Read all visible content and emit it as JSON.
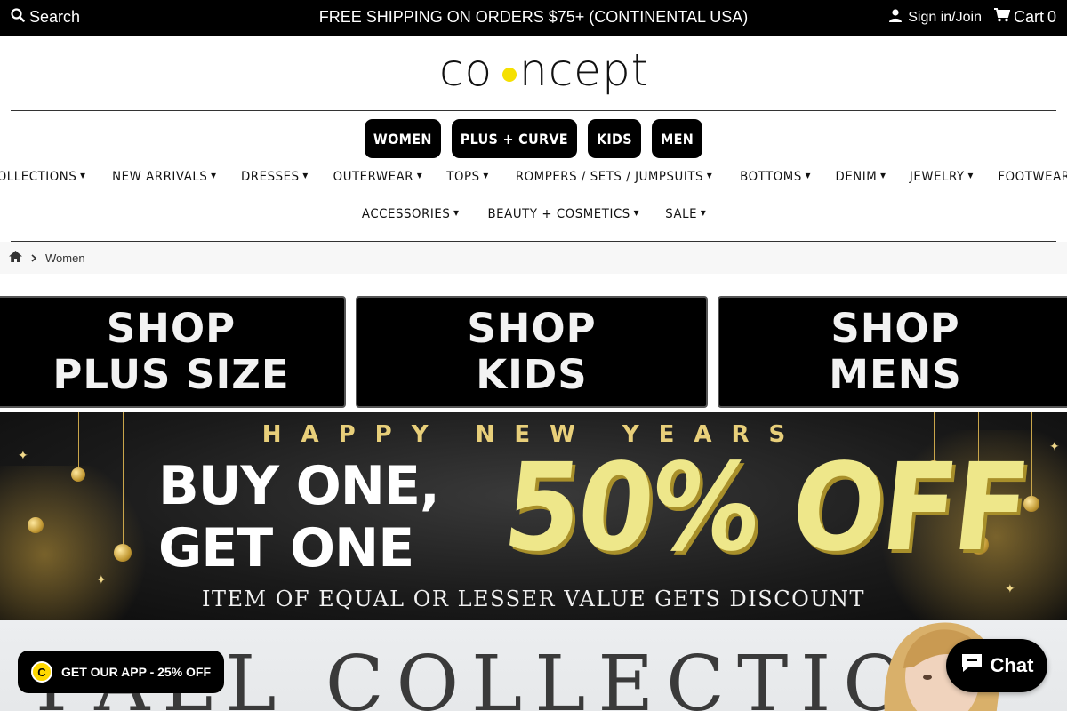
{
  "topbar": {
    "search_label": "Search",
    "promo": "FREE SHIPPING ON ORDERS $75+ (CONTINENTAL USA)",
    "signin_label": "Sign in/Join",
    "cart_label": "Cart",
    "cart_count": "0"
  },
  "logo": {
    "text": "co ncept",
    "accent_color": "#f5e000"
  },
  "pills": [
    "WOMEN",
    "PLUS + CURVE",
    "KIDS",
    "MEN"
  ],
  "nav": {
    "row1": [
      "COLLECTIONS",
      "NEW ARRIVALS",
      "DRESSES",
      "OUTERWEAR",
      "TOPS",
      "ROMPERS / SETS / JUMPSUITS",
      "BOTTOMS",
      "DENIM",
      "JEWELRY",
      "FOOTWEAR"
    ],
    "row2": [
      "ACCESSORIES",
      "BEAUTY + COSMETICS",
      "SALE"
    ]
  },
  "breadcrumb": {
    "current": "Women"
  },
  "tiles": [
    {
      "line1": "SHOP",
      "line2": "PLUS SIZE"
    },
    {
      "line1": "SHOP",
      "line2": "KIDS"
    },
    {
      "line1": "SHOP",
      "line2": "MENS"
    }
  ],
  "banner": {
    "headline": "HAPPY NEW YEARS",
    "line1": "BUY ONE,",
    "line2": "GET ONE",
    "discount": "50% OFF",
    "fineprint": "ITEM OF EQUAL OR LESSER VALUE GETS DISCOUNT",
    "gold_color": "#e8cf7a"
  },
  "fall": {
    "title": "FALL COLLECTION"
  },
  "app_popup": {
    "icon_letter": "C",
    "label": "GET OUR APP - 25% OFF"
  },
  "chat": {
    "label": "Chat"
  }
}
